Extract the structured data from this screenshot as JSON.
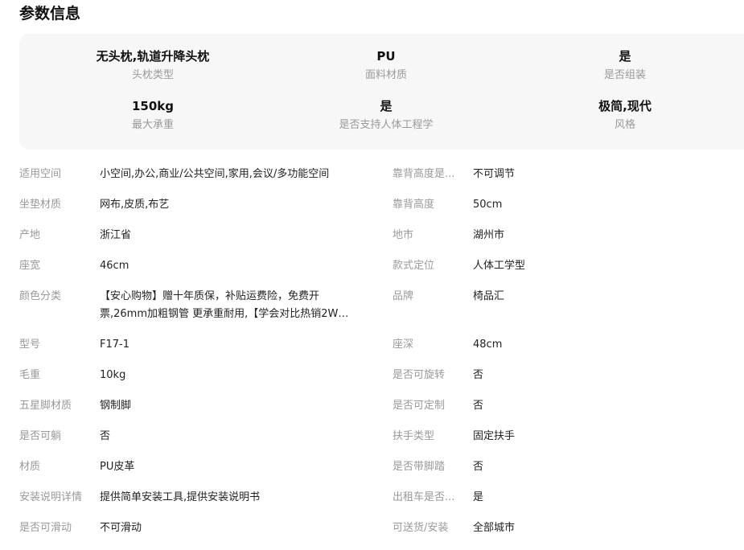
{
  "section_title": "参数信息",
  "highlights": [
    {
      "value": "无头枕,轨道升降头枕",
      "label": "头枕类型"
    },
    {
      "value": "PU",
      "label": "面料材质"
    },
    {
      "value": "是",
      "label": "是否组装"
    },
    {
      "value": "150kg",
      "label": "最大承重"
    },
    {
      "value": "是",
      "label": "是否支持人体工程学"
    },
    {
      "value": "极简,现代",
      "label": "风格"
    }
  ],
  "params": [
    {
      "left": {
        "label": "适用空间",
        "value": "小空间,办公,商业/公共空间,家用,会议/多功能空间"
      },
      "right": {
        "label": "靠背高度是...",
        "value": "不可调节"
      }
    },
    {
      "left": {
        "label": "坐垫材质",
        "value": "网布,皮质,布艺"
      },
      "right": {
        "label": "靠背高度",
        "value": "50cm"
      }
    },
    {
      "left": {
        "label": "产地",
        "value": "浙江省"
      },
      "right": {
        "label": "地市",
        "value": "湖州市"
      }
    },
    {
      "left": {
        "label": "座宽",
        "value": "46cm"
      },
      "right": {
        "label": "款式定位",
        "value": "人体工学型"
      }
    },
    {
      "left": {
        "label": "颜色分类",
        "value": "【安心购物】赠十年质保，补贴运费险，免费开票,26mm加粗钢管 更承重耐用,【学会对比热销2W件..."
      },
      "right": {
        "label": "品牌",
        "value": "椅品汇"
      }
    },
    {
      "left": {
        "label": "型号",
        "value": "F17-1"
      },
      "right": {
        "label": "座深",
        "value": "48cm"
      }
    },
    {
      "left": {
        "label": "毛重",
        "value": "10kg"
      },
      "right": {
        "label": "是否可旋转",
        "value": "否"
      }
    },
    {
      "left": {
        "label": "五星脚材质",
        "value": "钢制脚"
      },
      "right": {
        "label": "是否可定制",
        "value": "否"
      }
    },
    {
      "left": {
        "label": "是否可躺",
        "value": "否"
      },
      "right": {
        "label": "扶手类型",
        "value": "固定扶手"
      }
    },
    {
      "left": {
        "label": "材质",
        "value": "PU皮革"
      },
      "right": {
        "label": "是否带脚踏",
        "value": "否"
      }
    },
    {
      "left": {
        "label": "安装说明详情",
        "value": "提供简单安装工具,提供安装说明书"
      },
      "right": {
        "label": "出租车是否...",
        "value": "是"
      }
    },
    {
      "left": {
        "label": "是否可滑动",
        "value": "不可滑动"
      },
      "right": {
        "label": "可送货/安装",
        "value": "全部城市"
      }
    }
  ]
}
